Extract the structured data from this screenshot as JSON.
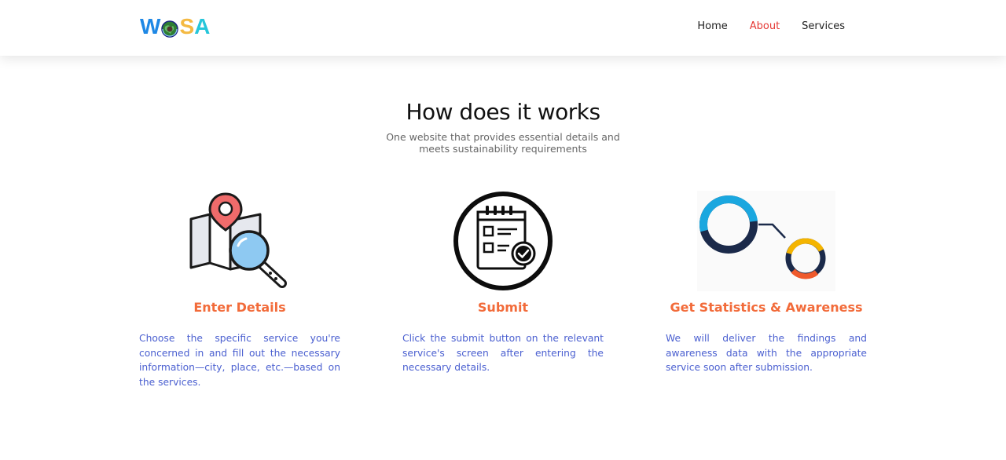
{
  "header": {
    "logo": {
      "part1": "W",
      "part2": "SA"
    },
    "nav": [
      {
        "label": "Home",
        "active": false
      },
      {
        "label": "About",
        "active": true
      },
      {
        "label": "Services",
        "active": false
      }
    ]
  },
  "section": {
    "title": "How does it works",
    "subtitle": "One website that provides essential details and meets sustainability requirements"
  },
  "cards": [
    {
      "icon": "map-search-icon",
      "title": "Enter Details",
      "text": "Choose the specific service you're concerned in and fill out the necessary information—city, place, etc.—based on the services."
    },
    {
      "icon": "checklist-icon",
      "title": "Submit",
      "text": "Click the submit button on the relevant service's screen after entering the necessary details."
    },
    {
      "icon": "statistics-rings-icon",
      "title": "Get Statistics & Awareness",
      "text": "We will deliver the findings and awareness data with the appropriate service soon after submission."
    }
  ],
  "colors": {
    "accent": "#f26b3a",
    "nav_active": "#e53935",
    "body_text": "#4a5fd0",
    "logo_blue": "#1e88e5",
    "logo_yellow": "#f4b942",
    "logo_cyan": "#26c6da"
  }
}
